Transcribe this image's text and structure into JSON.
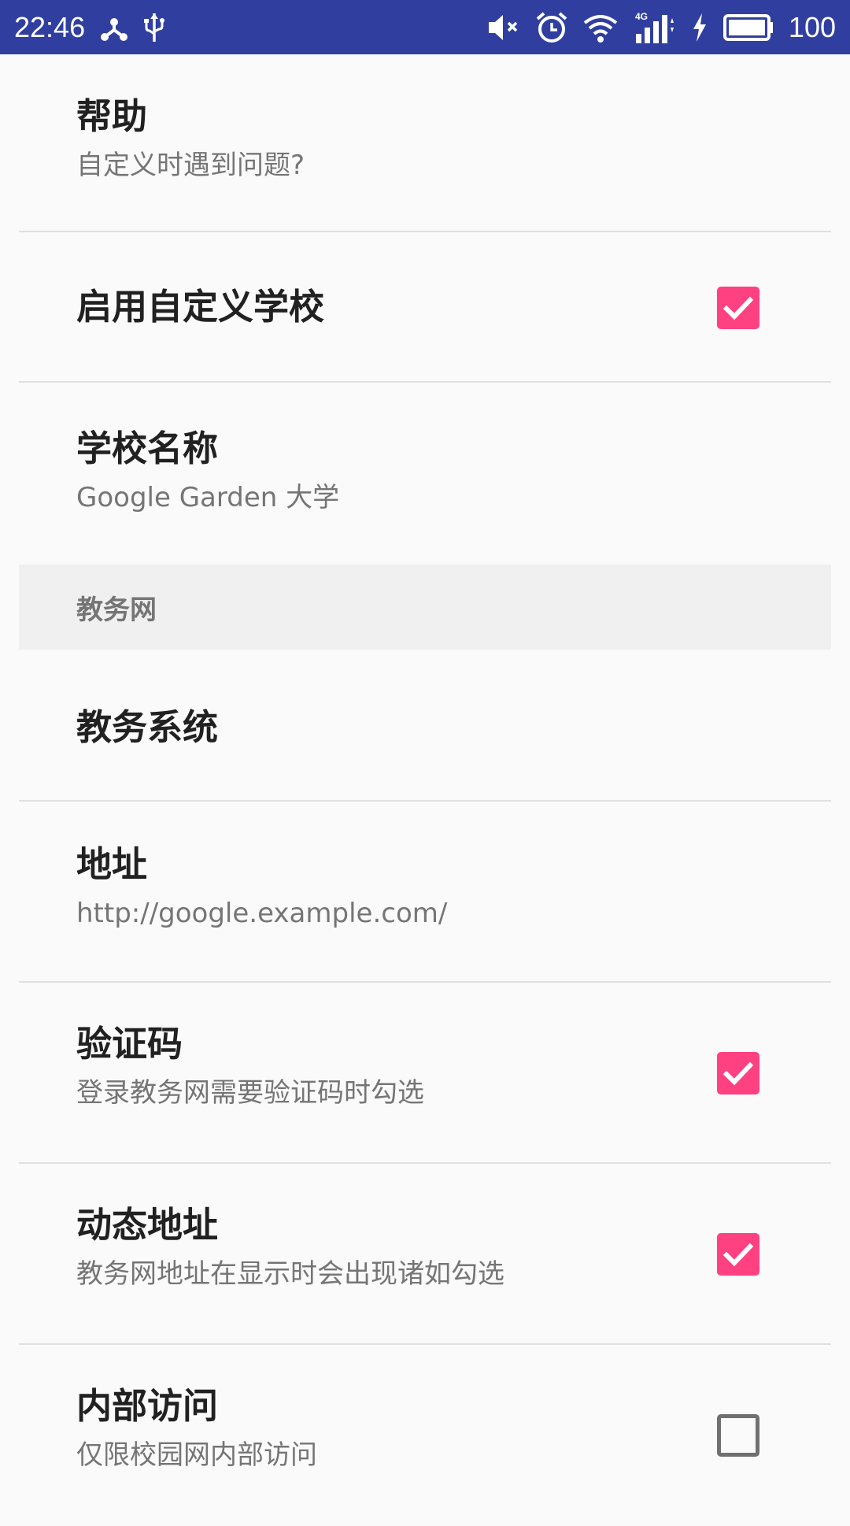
{
  "status_bar": {
    "time": "22:46",
    "battery_level": "100",
    "icons_left": [
      "usb-tether-icon",
      "usb-icon"
    ],
    "icons_right": [
      "mute-icon",
      "alarm-icon",
      "wifi-icon",
      "signal-4g-icon",
      "charging-icon",
      "battery-icon"
    ],
    "background_color": "#303f9f"
  },
  "preferences": {
    "help": {
      "title": "帮助",
      "summary": "自定义时遇到问题?"
    },
    "enable_custom_school": {
      "title": "启用自定义学校",
      "checked": true
    },
    "school_name": {
      "title": "学校名称",
      "summary": "Google Garden 大学"
    },
    "category_academic": {
      "title": "教务网"
    },
    "academic_system": {
      "title": "教务系统"
    },
    "address": {
      "title": "地址",
      "summary": "http://google.example.com/"
    },
    "captcha": {
      "title": "验证码",
      "summary": "登录教务网需要验证码时勾选",
      "checked": true
    },
    "dynamic_address": {
      "title": "动态地址",
      "summary": "教务网地址在显示时会出现诸如勾选",
      "checked": true
    },
    "internal_access": {
      "title": "内部访问",
      "summary": "仅限校园网内部访问",
      "checked": false
    }
  },
  "colors": {
    "accent": "#ff4081",
    "title_text": "#212121",
    "summary_text": "#757575",
    "divider": "#e0e0e0",
    "category_background": "#f0f0f0"
  }
}
